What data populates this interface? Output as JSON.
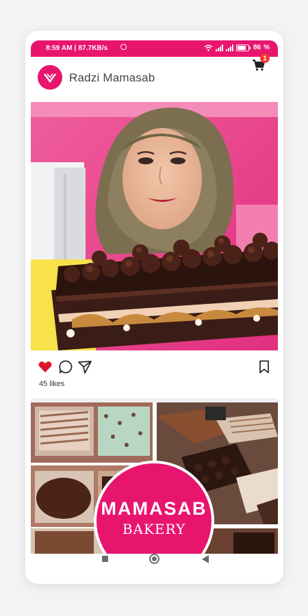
{
  "status_bar": {
    "time_speed": "8:59 AM | 87.7KB/s",
    "battery": "86"
  },
  "profile": {
    "name": "Radzi Mamasab"
  },
  "cart": {
    "badge_count": "1"
  },
  "post": {
    "likes_text": "45 likes"
  },
  "logo": {
    "line1": "MAMASAB",
    "line2": "BAKERY"
  },
  "colors": {
    "brand_pink": "#e8156f",
    "like_red": "#e0152a",
    "badge_red": "#f23a2f"
  },
  "icons": {
    "like": "heart-icon",
    "comment": "comment-icon",
    "share": "send-icon",
    "save": "bookmark-icon",
    "cart": "cart-icon"
  }
}
